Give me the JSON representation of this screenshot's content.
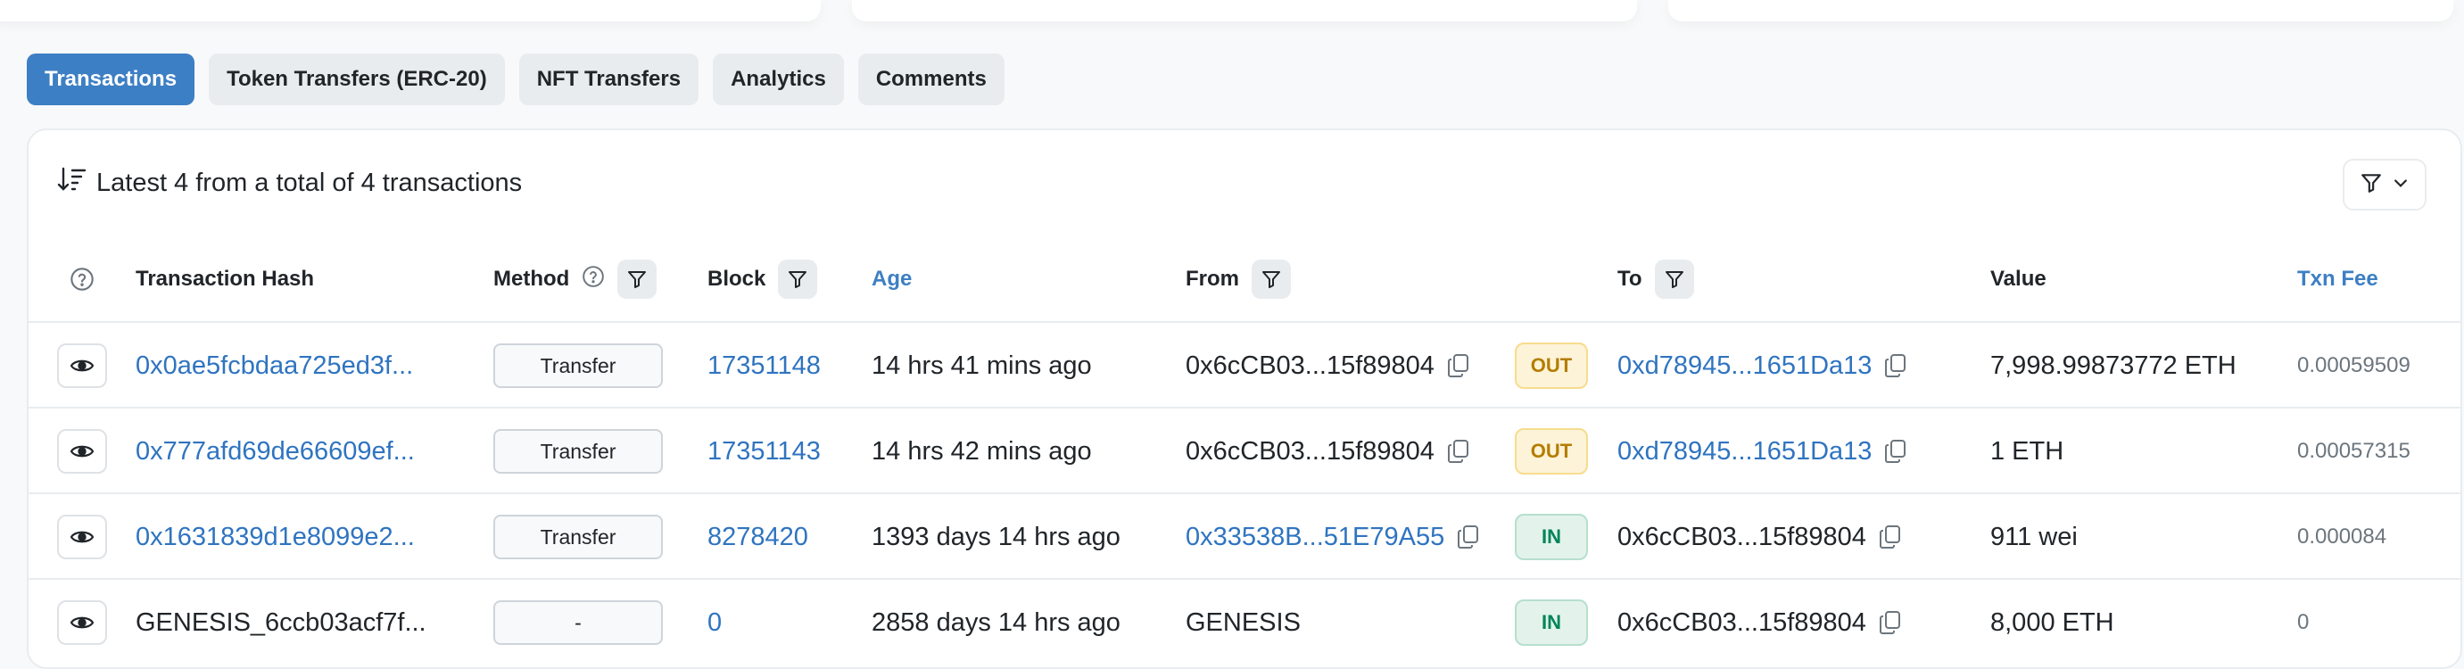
{
  "tabs": [
    {
      "label": "Transactions",
      "active": true
    },
    {
      "label": "Token Transfers (ERC-20)",
      "active": false
    },
    {
      "label": "NFT Transfers",
      "active": false
    },
    {
      "label": "Analytics",
      "active": false
    },
    {
      "label": "Comments",
      "active": false
    }
  ],
  "summary": "Latest 4 from a total of 4 transactions",
  "columns": {
    "hash": "Transaction Hash",
    "method": "Method",
    "block": "Block",
    "age": "Age",
    "from": "From",
    "to": "To",
    "value": "Value",
    "fee": "Txn Fee"
  },
  "rows": [
    {
      "hash": "0x0ae5fcbdaa725ed3f...",
      "method": "Transfer",
      "block": "17351148",
      "age": "14 hrs 41 mins ago",
      "from": "0x6cCB03...15f89804",
      "direction": "OUT",
      "to": "0xd78945...1651Da13",
      "value": "7,998.99873772 ETH",
      "fee": "0.00059509"
    },
    {
      "hash": "0x777afd69de66609ef...",
      "method": "Transfer",
      "block": "17351143",
      "age": "14 hrs 42 mins ago",
      "from": "0x6cCB03...15f89804",
      "direction": "OUT",
      "to": "0xd78945...1651Da13",
      "value": "1 ETH",
      "fee": "0.00057315"
    },
    {
      "hash": "0x1631839d1e8099e2...",
      "method": "Transfer",
      "block": "8278420",
      "age": "1393 days 14 hrs ago",
      "from": "0x33538B...51E79A55",
      "direction": "IN",
      "to": "0x6cCB03...15f89804",
      "value": "911 wei",
      "fee": "0.000084"
    },
    {
      "hash": "GENESIS_6ccb03acf7f...",
      "method": "-",
      "block": "0",
      "age": "2858 days 14 hrs ago",
      "from": "GENESIS",
      "direction": "IN",
      "to": "0x6cCB03...15f89804",
      "value": "8,000 ETH",
      "fee": "0"
    }
  ],
  "colors": {
    "accent": "#3d7fc4",
    "link": "#2f74c0",
    "out_bg": "#fdf3d8",
    "in_bg": "#e3f3ec"
  }
}
